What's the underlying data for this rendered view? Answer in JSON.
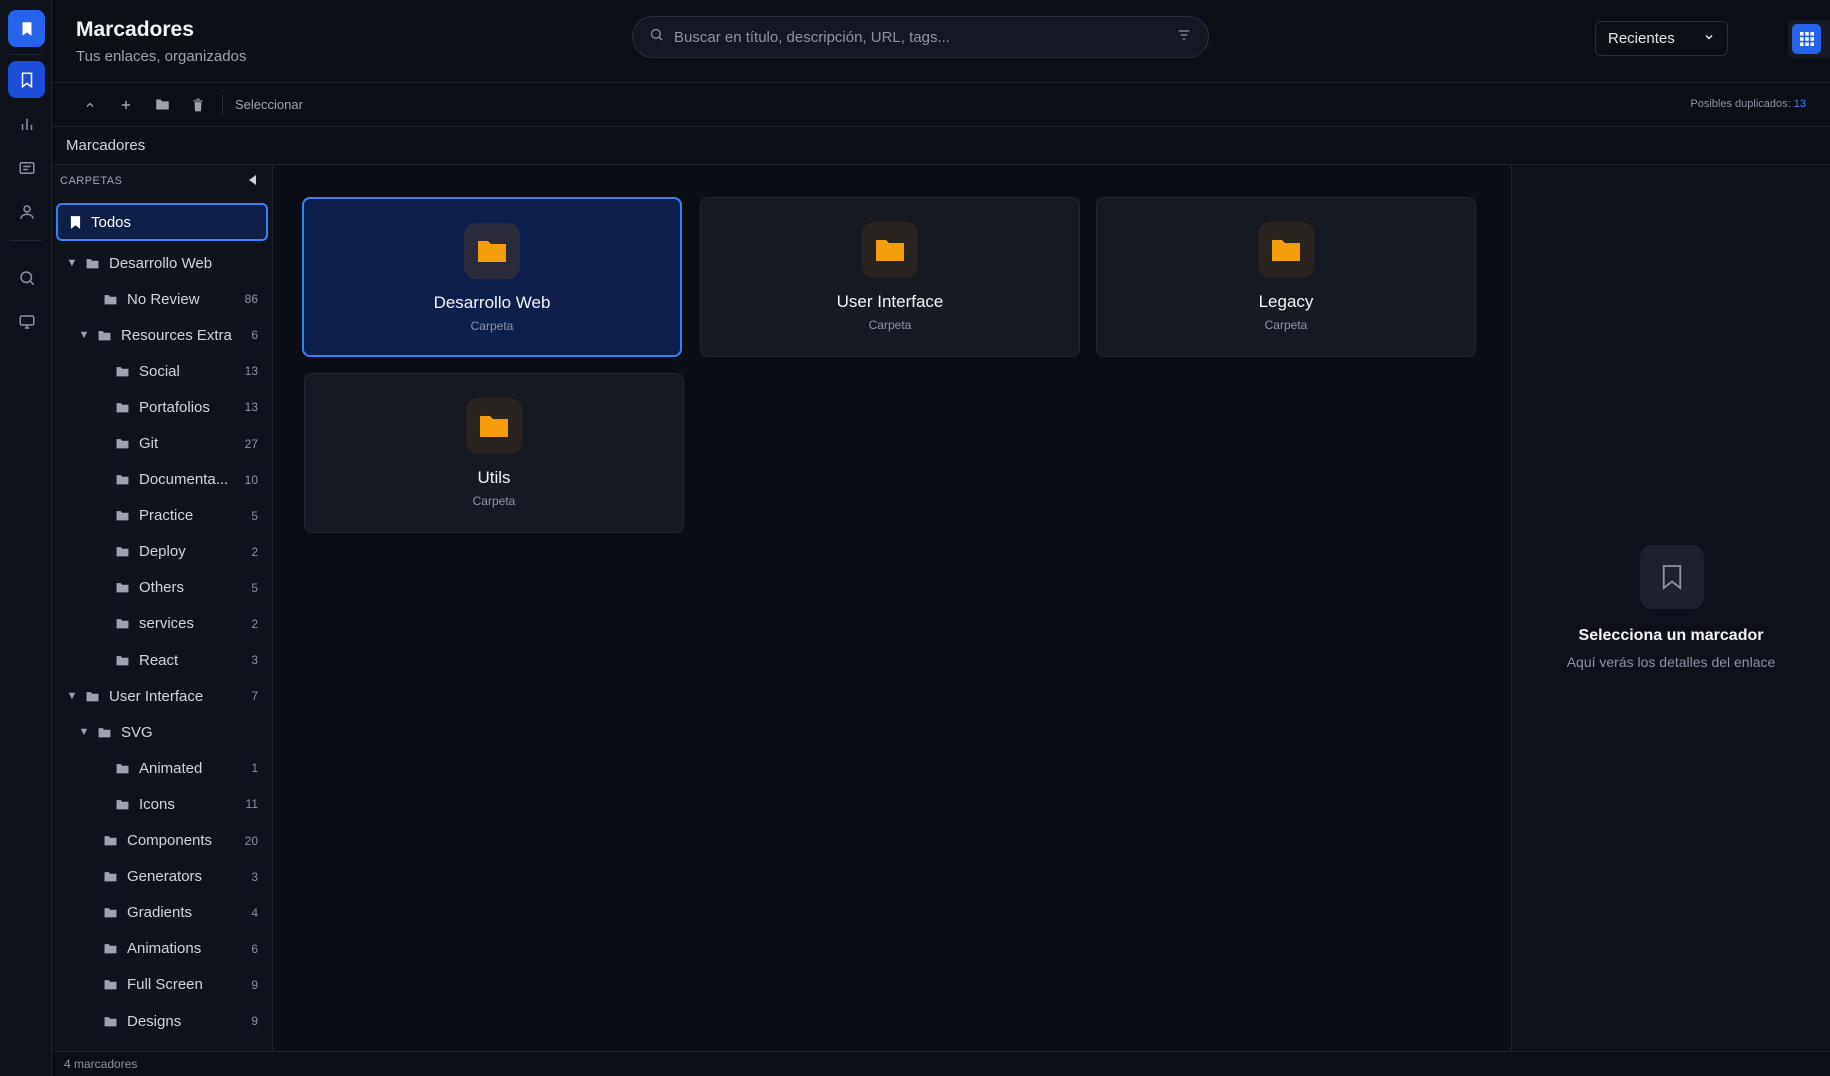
{
  "header": {
    "title": "Marcadores",
    "subtitle": "Tus enlaces, organizados",
    "search_placeholder": "Buscar en título, descripción, URL, tags...",
    "sort_value": "Recientes"
  },
  "toolbar": {
    "select_label": "Seleccionar",
    "dupes_label": "Posibles duplicados:",
    "dupes_count": "13"
  },
  "breadcrumb": "Marcadores",
  "sidebar": {
    "heading": "CARPETAS",
    "all_label": "Todos",
    "tree": {
      "desarrollo_web": "Desarrollo Web",
      "no_review": {
        "name": "No Review",
        "count": "86"
      },
      "resources_extra": {
        "name": "Resources Extra",
        "count": "6"
      },
      "social": {
        "name": "Social",
        "count": "13"
      },
      "portafolios": {
        "name": "Portafolios",
        "count": "13"
      },
      "git": {
        "name": "Git",
        "count": "27"
      },
      "documenta": {
        "name": "Documenta...",
        "count": "10"
      },
      "practice": {
        "name": "Practice",
        "count": "5"
      },
      "deploy": {
        "name": "Deploy",
        "count": "2"
      },
      "others": {
        "name": "Others",
        "count": "5"
      },
      "services": {
        "name": "services",
        "count": "2"
      },
      "react": {
        "name": "React",
        "count": "3"
      },
      "user_interface": {
        "name": "User Interface",
        "count": "7"
      },
      "svg": {
        "name": "SVG"
      },
      "animated": {
        "name": "Animated",
        "count": "1"
      },
      "icons": {
        "name": "Icons",
        "count": "11"
      },
      "components": {
        "name": "Components",
        "count": "20"
      },
      "generators": {
        "name": "Generators",
        "count": "3"
      },
      "gradients": {
        "name": "Gradients",
        "count": "4"
      },
      "animations": {
        "name": "Animations",
        "count": "6"
      },
      "full_screen": {
        "name": "Full Screen",
        "count": "9"
      },
      "designs": {
        "name": "Designs",
        "count": "9"
      }
    }
  },
  "cards": [
    {
      "name": "Desarrollo Web",
      "type": "Carpeta"
    },
    {
      "name": "User Interface",
      "type": "Carpeta"
    },
    {
      "name": "Legacy",
      "type": "Carpeta"
    },
    {
      "name": "Utils",
      "type": "Carpeta"
    }
  ],
  "details": {
    "title": "Selecciona un marcador",
    "subtitle": "Aquí verás los detalles del enlace"
  },
  "footer": "4 marcadores",
  "colors": {
    "accent": "#2563eb",
    "folder": "#f59e0b",
    "background": "#0b0e14"
  }
}
